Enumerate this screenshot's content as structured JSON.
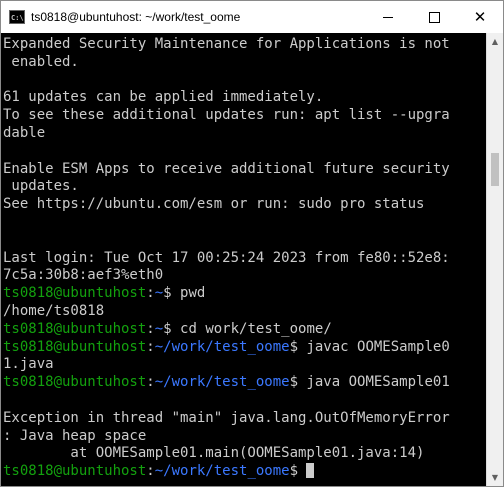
{
  "window": {
    "title": "ts0818@ubuntuhost: ~/work/test_oome",
    "app_icon_text": "C:\\",
    "close_glyph": "✕"
  },
  "terminal": {
    "lines": [
      {
        "text": "Expanded Security Maintenance for Applications is not"
      },
      {
        "text": " enabled."
      },
      {
        "text": ""
      },
      {
        "text": "61 updates can be applied immediately."
      },
      {
        "text": "To see these additional updates run: apt list --upgra"
      },
      {
        "text": "dable"
      },
      {
        "text": ""
      },
      {
        "text": "Enable ESM Apps to receive additional future security"
      },
      {
        "text": " updates."
      },
      {
        "text": "See https://ubuntu.com/esm or run: sudo pro status"
      },
      {
        "text": ""
      },
      {
        "text": ""
      },
      {
        "text": "Last login: Tue Oct 17 00:25:24 2023 from fe80::52e8:"
      },
      {
        "text": "7c5a:30b8:aef3%eth0"
      },
      {
        "prompt": {
          "user": "ts0818@ubuntuhost",
          "sep": ":",
          "path": "~",
          "end": "$ "
        },
        "text": "pwd"
      },
      {
        "text": "/home/ts0818"
      },
      {
        "prompt": {
          "user": "ts0818@ubuntuhost",
          "sep": ":",
          "path": "~",
          "end": "$ "
        },
        "text": "cd work/test_oome/"
      },
      {
        "prompt": {
          "user": "ts0818@ubuntuhost",
          "sep": ":",
          "path": "~/work/test_oome",
          "end": "$ "
        },
        "text": "javac OOMESample0"
      },
      {
        "text": "1.java"
      },
      {
        "prompt": {
          "user": "ts0818@ubuntuhost",
          "sep": ":",
          "path": "~/work/test_oome",
          "end": "$ "
        },
        "text": "java OOMESample01"
      },
      {
        "text": ""
      },
      {
        "text": "Exception in thread \"main\" java.lang.OutOfMemoryError"
      },
      {
        "text": ": Java heap space"
      },
      {
        "text": "        at OOMESample01.main(OOMESample01.java:14)"
      },
      {
        "prompt": {
          "user": "ts0818@ubuntuhost",
          "sep": ":",
          "path": "~/work/test_oome",
          "end": "$ "
        },
        "text": "",
        "cursor": true
      }
    ]
  },
  "colors": {
    "background": "#000000",
    "text": "#cccccc",
    "prompt_user": "#13a10e",
    "prompt_path": "#3b78ff"
  },
  "scrollbar": {
    "up_icon": "▲",
    "down_icon": "▼"
  }
}
